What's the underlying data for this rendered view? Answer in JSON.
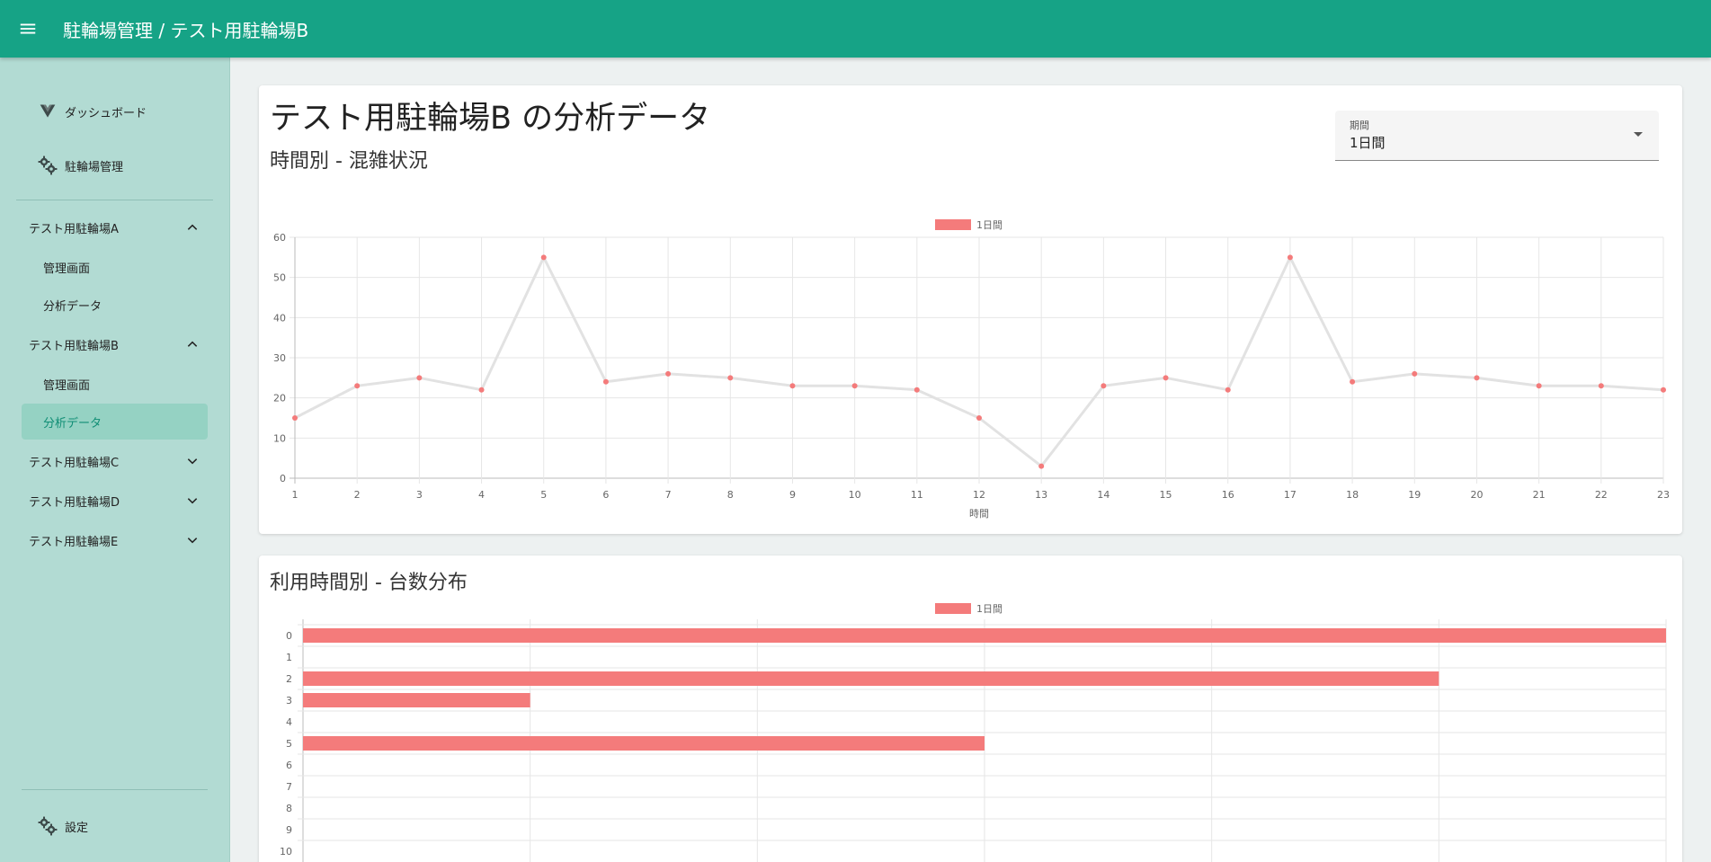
{
  "app": {
    "title": "駐輪場管理 / テスト用駐輪場B"
  },
  "sidebar": {
    "top_items": [
      {
        "label": "ダッシュボード",
        "icon": "vue-logo-icon"
      },
      {
        "label": "駐輪場管理",
        "icon": "gears-icon"
      }
    ],
    "groups": [
      {
        "label": "テスト用駐輪場A",
        "expanded": true,
        "children": [
          "管理画面",
          "分析データ"
        ]
      },
      {
        "label": "テスト用駐輪場B",
        "expanded": true,
        "children": [
          "管理画面",
          "分析データ"
        ]
      },
      {
        "label": "テスト用駐輪場C",
        "expanded": false,
        "children": []
      },
      {
        "label": "テスト用駐輪場D",
        "expanded": false,
        "children": []
      },
      {
        "label": "テスト用駐輪場E",
        "expanded": false,
        "children": []
      }
    ],
    "active": "テスト用駐輪場B / 分析データ",
    "settings_label": "設定"
  },
  "main": {
    "page_title": "テスト用駐輪場B の分析データ",
    "section1_title": "時間別 - 混雑状況",
    "section2_title": "利用時間別 - 台数分布",
    "period": {
      "label": "期間",
      "value": "1日間"
    }
  },
  "colors": {
    "header": "#16a386",
    "sidebar": "#b2dbd3",
    "accent": "#0f8d74",
    "series": "#f47b7b",
    "line": "#e2e2e2"
  },
  "chart_data": [
    {
      "type": "line",
      "legend": "1日間",
      "x": [
        1,
        2,
        3,
        4,
        5,
        6,
        7,
        8,
        9,
        10,
        11,
        12,
        13,
        14,
        15,
        16,
        17,
        18,
        19,
        20,
        21,
        22,
        23
      ],
      "values": [
        15,
        23,
        25,
        22,
        55,
        24,
        26,
        25,
        23,
        23,
        22,
        15,
        3,
        23,
        25,
        22,
        55,
        24,
        26,
        25,
        23,
        23,
        22
      ],
      "xlabel": "時間",
      "ylim": [
        0,
        60
      ],
      "yticks": [
        0,
        10,
        20,
        30,
        40,
        50,
        60
      ],
      "grid": true,
      "legend_position": "top"
    },
    {
      "type": "bar",
      "orientation": "horizontal",
      "legend": "1日間",
      "categories": [
        "0",
        "1",
        "2",
        "3",
        "4",
        "5",
        "6",
        "7",
        "8",
        "9",
        "10"
      ],
      "values": [
        6,
        0,
        5,
        1,
        0,
        3,
        0,
        0,
        0,
        0,
        0
      ],
      "xlim": [
        0,
        6
      ],
      "grid": true,
      "legend_position": "top"
    }
  ]
}
